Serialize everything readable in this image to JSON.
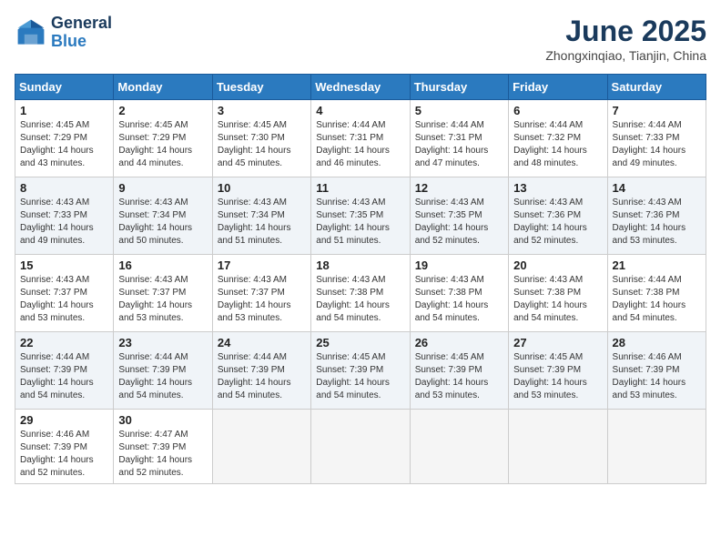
{
  "header": {
    "logo_line1": "General",
    "logo_line2": "Blue",
    "month_title": "June 2025",
    "location": "Zhongxinqiao, Tianjin, China"
  },
  "weekdays": [
    "Sunday",
    "Monday",
    "Tuesday",
    "Wednesday",
    "Thursday",
    "Friday",
    "Saturday"
  ],
  "weeks": [
    [
      {
        "day": "1",
        "sunrise": "4:45 AM",
        "sunset": "7:29 PM",
        "daylight": "14 hours and 43 minutes."
      },
      {
        "day": "2",
        "sunrise": "4:45 AM",
        "sunset": "7:29 PM",
        "daylight": "14 hours and 44 minutes."
      },
      {
        "day": "3",
        "sunrise": "4:45 AM",
        "sunset": "7:30 PM",
        "daylight": "14 hours and 45 minutes."
      },
      {
        "day": "4",
        "sunrise": "4:44 AM",
        "sunset": "7:31 PM",
        "daylight": "14 hours and 46 minutes."
      },
      {
        "day": "5",
        "sunrise": "4:44 AM",
        "sunset": "7:31 PM",
        "daylight": "14 hours and 47 minutes."
      },
      {
        "day": "6",
        "sunrise": "4:44 AM",
        "sunset": "7:32 PM",
        "daylight": "14 hours and 48 minutes."
      },
      {
        "day": "7",
        "sunrise": "4:44 AM",
        "sunset": "7:33 PM",
        "daylight": "14 hours and 49 minutes."
      }
    ],
    [
      {
        "day": "8",
        "sunrise": "4:43 AM",
        "sunset": "7:33 PM",
        "daylight": "14 hours and 49 minutes."
      },
      {
        "day": "9",
        "sunrise": "4:43 AM",
        "sunset": "7:34 PM",
        "daylight": "14 hours and 50 minutes."
      },
      {
        "day": "10",
        "sunrise": "4:43 AM",
        "sunset": "7:34 PM",
        "daylight": "14 hours and 51 minutes."
      },
      {
        "day": "11",
        "sunrise": "4:43 AM",
        "sunset": "7:35 PM",
        "daylight": "14 hours and 51 minutes."
      },
      {
        "day": "12",
        "sunrise": "4:43 AM",
        "sunset": "7:35 PM",
        "daylight": "14 hours and 52 minutes."
      },
      {
        "day": "13",
        "sunrise": "4:43 AM",
        "sunset": "7:36 PM",
        "daylight": "14 hours and 52 minutes."
      },
      {
        "day": "14",
        "sunrise": "4:43 AM",
        "sunset": "7:36 PM",
        "daylight": "14 hours and 53 minutes."
      }
    ],
    [
      {
        "day": "15",
        "sunrise": "4:43 AM",
        "sunset": "7:37 PM",
        "daylight": "14 hours and 53 minutes."
      },
      {
        "day": "16",
        "sunrise": "4:43 AM",
        "sunset": "7:37 PM",
        "daylight": "14 hours and 53 minutes."
      },
      {
        "day": "17",
        "sunrise": "4:43 AM",
        "sunset": "7:37 PM",
        "daylight": "14 hours and 53 minutes."
      },
      {
        "day": "18",
        "sunrise": "4:43 AM",
        "sunset": "7:38 PM",
        "daylight": "14 hours and 54 minutes."
      },
      {
        "day": "19",
        "sunrise": "4:43 AM",
        "sunset": "7:38 PM",
        "daylight": "14 hours and 54 minutes."
      },
      {
        "day": "20",
        "sunrise": "4:43 AM",
        "sunset": "7:38 PM",
        "daylight": "14 hours and 54 minutes."
      },
      {
        "day": "21",
        "sunrise": "4:44 AM",
        "sunset": "7:38 PM",
        "daylight": "14 hours and 54 minutes."
      }
    ],
    [
      {
        "day": "22",
        "sunrise": "4:44 AM",
        "sunset": "7:39 PM",
        "daylight": "14 hours and 54 minutes."
      },
      {
        "day": "23",
        "sunrise": "4:44 AM",
        "sunset": "7:39 PM",
        "daylight": "14 hours and 54 minutes."
      },
      {
        "day": "24",
        "sunrise": "4:44 AM",
        "sunset": "7:39 PM",
        "daylight": "14 hours and 54 minutes."
      },
      {
        "day": "25",
        "sunrise": "4:45 AM",
        "sunset": "7:39 PM",
        "daylight": "14 hours and 54 minutes."
      },
      {
        "day": "26",
        "sunrise": "4:45 AM",
        "sunset": "7:39 PM",
        "daylight": "14 hours and 53 minutes."
      },
      {
        "day": "27",
        "sunrise": "4:45 AM",
        "sunset": "7:39 PM",
        "daylight": "14 hours and 53 minutes."
      },
      {
        "day": "28",
        "sunrise": "4:46 AM",
        "sunset": "7:39 PM",
        "daylight": "14 hours and 53 minutes."
      }
    ],
    [
      {
        "day": "29",
        "sunrise": "4:46 AM",
        "sunset": "7:39 PM",
        "daylight": "14 hours and 52 minutes."
      },
      {
        "day": "30",
        "sunrise": "4:47 AM",
        "sunset": "7:39 PM",
        "daylight": "14 hours and 52 minutes."
      },
      null,
      null,
      null,
      null,
      null
    ]
  ]
}
